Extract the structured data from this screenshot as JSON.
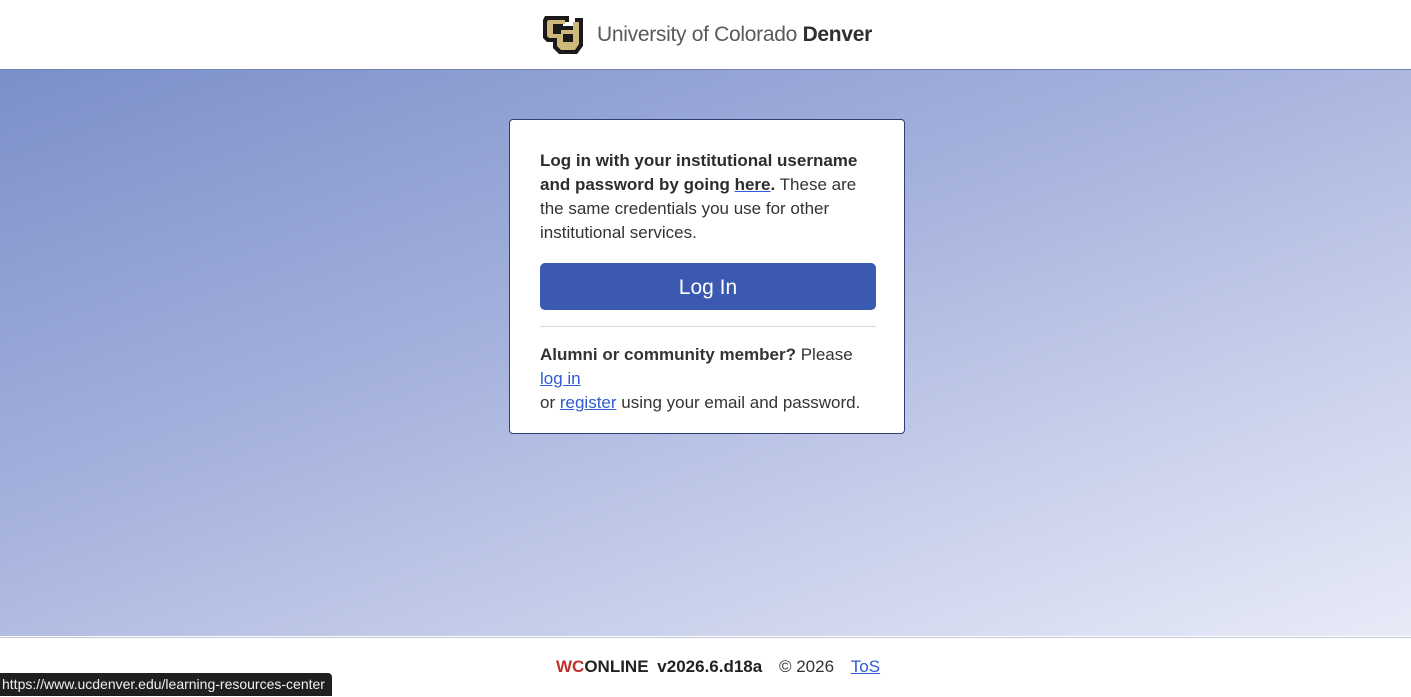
{
  "header": {
    "brand_prefix": "University of Colorado",
    "brand_bold": "Denver",
    "logo_text": "CU"
  },
  "login_card": {
    "intro_bold": "Log in with your institutional username and password by going",
    "intro_link": "here",
    "intro_period": ".",
    "intro_rest": " These are the same credentials you use for other institutional services.",
    "login_button": "Log In",
    "alumni_bold": "Alumni or community member?",
    "alumni_please": " Please ",
    "alumni_login_link": "log in",
    "alumni_or": " or ",
    "alumni_register_link": "register",
    "alumni_rest": " using your email and password."
  },
  "footer": {
    "brand_wc": "WC",
    "brand_online": "ONLINE",
    "version": "v2026.6.d18a",
    "copyright": "© 2026",
    "tos": "ToS"
  },
  "status_bar": {
    "url": "https://www.ucdenver.edu/learning-resources-center"
  },
  "colors": {
    "primary_button": "#3b59b0",
    "link": "#2f5bd0",
    "wc_red": "#c0312b",
    "logo_gold": "#cfb87c"
  }
}
